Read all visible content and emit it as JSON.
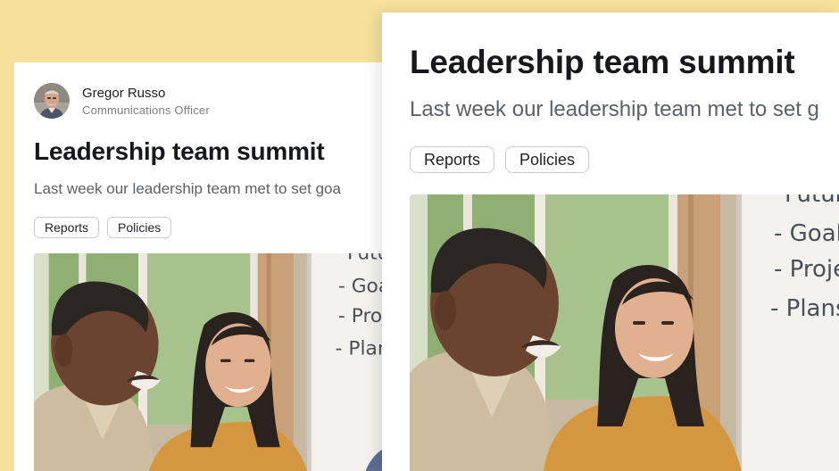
{
  "post": {
    "author": {
      "name": "Gregor Russo",
      "role": "Communications Officer"
    },
    "title": "Leadership team summit",
    "excerpt_preview": "Last week our leadership team met to set goa",
    "excerpt_zoom": "Last week our leadership team met to set g",
    "tags": [
      {
        "label": "Reports"
      },
      {
        "label": "Policies"
      }
    ],
    "image": {
      "whiteboard_lines": [
        "Futur",
        "- Goals",
        "- Project",
        "- Plans"
      ]
    }
  },
  "colors": {
    "background": "#f6e19b",
    "card": "#ffffff",
    "title": "#16181d",
    "excerpt": "#5b616b",
    "tag_border": "#c9ccd1"
  }
}
